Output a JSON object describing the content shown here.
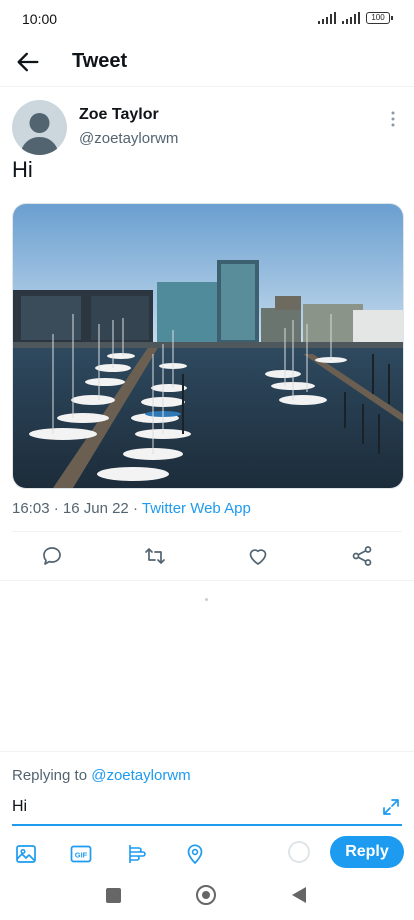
{
  "status": {
    "time": "10:00",
    "battery": "100"
  },
  "header": {
    "title": "Tweet"
  },
  "tweet": {
    "author_name": "Zoe Taylor",
    "author_handle": "@zoetaylorwm",
    "text": "Hi",
    "time": "16:03",
    "date": "16 Jun 22",
    "source": "Twitter Web App"
  },
  "reply": {
    "replying_prefix": "Replying to",
    "replying_handle": "@zoetaylorwm",
    "input_value": "Hi",
    "button_label": "Reply"
  },
  "colors": {
    "accent": "#1d9bf0",
    "text": "#0f1419",
    "muted": "#536471"
  },
  "icons": {
    "actions": [
      "reply-icon",
      "retweet-icon",
      "like-icon",
      "share-icon"
    ],
    "composer": [
      "image-icon",
      "gif-icon",
      "poll-icon",
      "location-icon"
    ]
  }
}
